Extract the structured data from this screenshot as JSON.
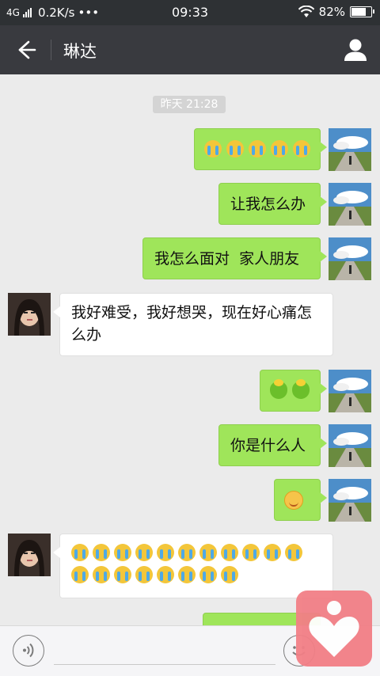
{
  "status_bar": {
    "network": "4G",
    "speed": "0.2K/s",
    "more": "•••",
    "time": "09:33",
    "battery": "82%",
    "battery_level": 0.82
  },
  "header": {
    "title": "琳达",
    "back_icon": "arrow-left-icon",
    "profile_icon": "person-icon"
  },
  "timestamp": "昨天 21:28",
  "messages": [
    {
      "from": "me",
      "type": "emoji",
      "emoji": "cry",
      "count": 5
    },
    {
      "from": "me",
      "type": "text",
      "text": "让我怎么办"
    },
    {
      "from": "me",
      "type": "text",
      "text": "我怎么面对  家人朋友"
    },
    {
      "from": "her",
      "type": "text",
      "text": "我好难受，我好想哭，现在好心痛怎么办"
    },
    {
      "from": "me",
      "type": "emoji",
      "emoji": "bean",
      "count": 2
    },
    {
      "from": "me",
      "type": "text",
      "text": "你是什么人"
    },
    {
      "from": "me",
      "type": "emoji",
      "emoji": "smile",
      "count": 1
    },
    {
      "from": "her",
      "type": "emoji",
      "emoji": "cry",
      "count": 19
    },
    {
      "from": "me",
      "type": "partial"
    }
  ],
  "input_bar": {
    "voice_icon": "voice-icon",
    "emoji_icon": "emoji-icon"
  },
  "overlay": {
    "icon": "heart-person-icon"
  },
  "colors": {
    "sent_bubble": "#9fe55a",
    "received_bubble": "#ffffff",
    "header_bg": "#393a3f",
    "status_bg": "#2e3134",
    "chat_bg": "#ebebeb",
    "overlay_bg": "#f27f86"
  }
}
